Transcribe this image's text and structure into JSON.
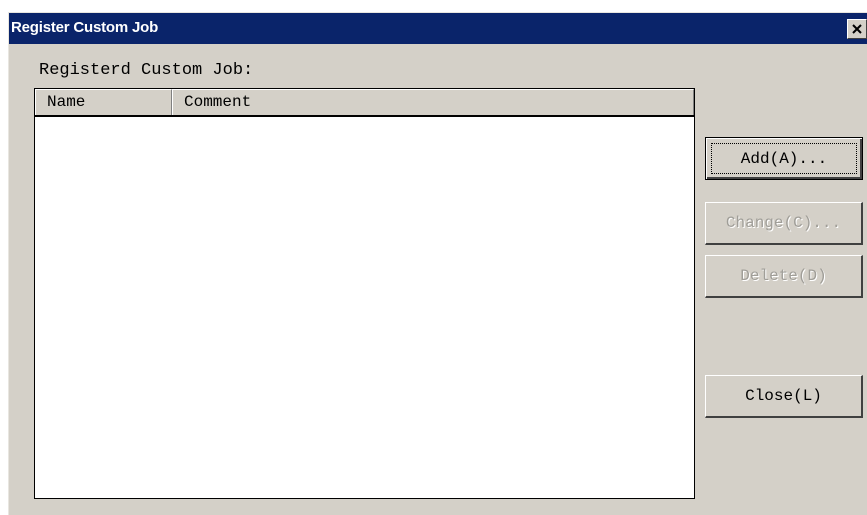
{
  "window": {
    "title": "Register Custom Job",
    "close_glyph": "close-icon"
  },
  "list": {
    "caption": "Registerd Custom Job:",
    "columns": [
      {
        "label": "Name"
      },
      {
        "label": "Comment"
      }
    ],
    "rows": []
  },
  "buttons": {
    "add": {
      "label": "Add(A)...",
      "enabled": true,
      "default": true
    },
    "change": {
      "label": "Change(C)...",
      "enabled": false
    },
    "delete": {
      "label": "Delete(D)",
      "enabled": false
    },
    "close": {
      "label": "Close(L)",
      "enabled": true
    }
  },
  "colors": {
    "titlebar": "#0a246a",
    "dialog_face": "#d4d0c8",
    "disabled_text": "#a09e98"
  }
}
